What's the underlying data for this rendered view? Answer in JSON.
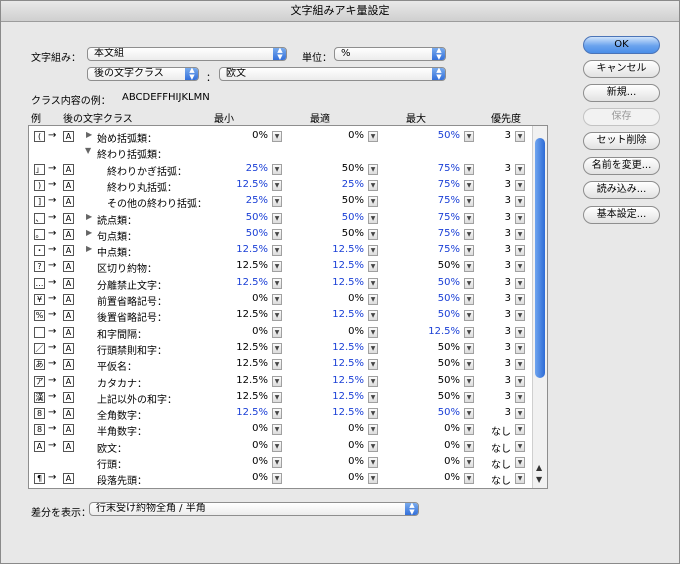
{
  "window": {
    "title": "文字組みアキ量設定"
  },
  "top": {
    "mojikumi_label": "文字組み：",
    "mojikumi_value": "本文組",
    "unit_label": "単位：",
    "unit_value": "%",
    "after_class_value": "後の文字クラス",
    "colon": "：",
    "class_value": "欧文",
    "example_label": "クラス内容の例：",
    "example_value": "ABCDEFFHIJKLMN"
  },
  "headers": {
    "example": "例",
    "after_class": "後の文字クラス",
    "min": "最小",
    "opt": "最適",
    "max": "最大",
    "priority": "優先度"
  },
  "buttons": {
    "ok": "OK",
    "cancel": "キャンセル",
    "new": "新規...",
    "save": "保存",
    "delete": "セット削除",
    "rename": "名前を変更...",
    "load": "読み込み...",
    "basic": "基本設定..."
  },
  "rows": [
    {
      "icon": "(",
      "tri": "▶",
      "name": "始め括弧類：",
      "indent": 0,
      "min": "0%",
      "opt": "0%",
      "max": "50%",
      "pri": "3",
      "bmin": false,
      "bopt": false,
      "bmax": true
    },
    {
      "icon": "",
      "tri": "▼",
      "name": "終わり括弧類：",
      "indent": 0,
      "min": "",
      "opt": "",
      "max": "",
      "pri": "",
      "bmin": false,
      "bopt": false,
      "bmax": false,
      "noicon": true
    },
    {
      "icon": "」",
      "tri": "",
      "name": "終わりかぎ括弧：",
      "indent": 1,
      "min": "25%",
      "opt": "50%",
      "max": "75%",
      "pri": "3",
      "bmin": true,
      "bopt": false,
      "bmax": true
    },
    {
      "icon": ")",
      "tri": "",
      "name": "終わり丸括弧：",
      "indent": 1,
      "min": "12.5%",
      "opt": "25%",
      "max": "75%",
      "pri": "3",
      "bmin": true,
      "bopt": true,
      "bmax": true
    },
    {
      "icon": "]",
      "tri": "",
      "name": "その他の終わり括弧：",
      "indent": 1,
      "min": "25%",
      "opt": "50%",
      "max": "75%",
      "pri": "3",
      "bmin": true,
      "bopt": false,
      "bmax": true
    },
    {
      "icon": "、",
      "tri": "▶",
      "name": "読点類：",
      "indent": 0,
      "min": "50%",
      "opt": "50%",
      "max": "75%",
      "pri": "3",
      "bmin": true,
      "bopt": true,
      "bmax": true
    },
    {
      "icon": "。",
      "tri": "▶",
      "name": "句点類：",
      "indent": 0,
      "min": "50%",
      "opt": "50%",
      "max": "75%",
      "pri": "3",
      "bmin": true,
      "bopt": false,
      "bmax": true
    },
    {
      "icon": "・",
      "tri": "▶",
      "name": "中点類：",
      "indent": 0,
      "min": "12.5%",
      "opt": "12.5%",
      "max": "75%",
      "pri": "3",
      "bmin": true,
      "bopt": true,
      "bmax": true
    },
    {
      "icon": "?",
      "tri": "",
      "name": "区切り約物：",
      "indent": 0,
      "min": "12.5%",
      "opt": "12.5%",
      "max": "50%",
      "pri": "3",
      "bmin": false,
      "bopt": true,
      "bmax": false
    },
    {
      "icon": "…",
      "tri": "",
      "name": "分離禁止文字：",
      "indent": 0,
      "min": "12.5%",
      "opt": "12.5%",
      "max": "50%",
      "pri": "3",
      "bmin": true,
      "bopt": true,
      "bmax": true
    },
    {
      "icon": "¥",
      "tri": "",
      "name": "前置省略記号：",
      "indent": 0,
      "min": "0%",
      "opt": "0%",
      "max": "50%",
      "pri": "3",
      "bmin": false,
      "bopt": false,
      "bmax": true
    },
    {
      "icon": "%",
      "tri": "",
      "name": "後置省略記号：",
      "indent": 0,
      "min": "12.5%",
      "opt": "12.5%",
      "max": "50%",
      "pri": "3",
      "bmin": false,
      "bopt": true,
      "bmax": true
    },
    {
      "icon": "",
      "tri": "",
      "name": "和字間隔：",
      "indent": 0,
      "min": "0%",
      "opt": "0%",
      "max": "12.5%",
      "pri": "3",
      "bmin": false,
      "bopt": false,
      "bmax": true
    },
    {
      "icon": "／",
      "tri": "",
      "name": "行頭禁則和字：",
      "indent": 0,
      "min": "12.5%",
      "opt": "12.5%",
      "max": "50%",
      "pri": "3",
      "bmin": false,
      "bopt": true,
      "bmax": false
    },
    {
      "icon": "あ",
      "tri": "",
      "name": "平仮名：",
      "indent": 0,
      "min": "12.5%",
      "opt": "12.5%",
      "max": "50%",
      "pri": "3",
      "bmin": false,
      "bopt": true,
      "bmax": false
    },
    {
      "icon": "ア",
      "tri": "",
      "name": "カタカナ：",
      "indent": 0,
      "min": "12.5%",
      "opt": "12.5%",
      "max": "50%",
      "pri": "3",
      "bmin": false,
      "bopt": true,
      "bmax": false
    },
    {
      "icon": "漢",
      "tri": "",
      "name": "上記以外の和字：",
      "indent": 0,
      "min": "12.5%",
      "opt": "12.5%",
      "max": "50%",
      "pri": "3",
      "bmin": false,
      "bopt": true,
      "bmax": false
    },
    {
      "icon": "8",
      "tri": "",
      "name": "全角数字：",
      "indent": 0,
      "min": "12.5%",
      "opt": "12.5%",
      "max": "50%",
      "pri": "3",
      "bmin": true,
      "bopt": true,
      "bmax": true
    },
    {
      "icon": "8",
      "tri": "",
      "name": "半角数字：",
      "indent": 0,
      "min": "0%",
      "opt": "0%",
      "max": "0%",
      "pri": "なし",
      "bmin": false,
      "bopt": false,
      "bmax": false
    },
    {
      "icon": "A",
      "tri": "",
      "name": "欧文：",
      "indent": 0,
      "min": "0%",
      "opt": "0%",
      "max": "0%",
      "pri": "なし",
      "bmin": false,
      "bopt": false,
      "bmax": false
    },
    {
      "icon": "",
      "tri": "",
      "name": "行頭：",
      "indent": 0,
      "min": "0%",
      "opt": "0%",
      "max": "0%",
      "pri": "なし",
      "bmin": false,
      "bopt": false,
      "bmax": false,
      "noicon": true
    },
    {
      "icon": "¶",
      "tri": "",
      "name": "段落先頭：",
      "indent": 0,
      "min": "0%",
      "opt": "0%",
      "max": "0%",
      "pri": "なし",
      "bmin": false,
      "bopt": false,
      "bmax": false
    }
  ],
  "arrow_glyph": "→",
  "target_icon": "A",
  "bottom": {
    "diff_label": "差分を表示：",
    "diff_value": "行末受け約物全角 / 半角"
  },
  "colors": {
    "blue_value": "#1a3fd6",
    "accent": "#2d6bd8"
  }
}
